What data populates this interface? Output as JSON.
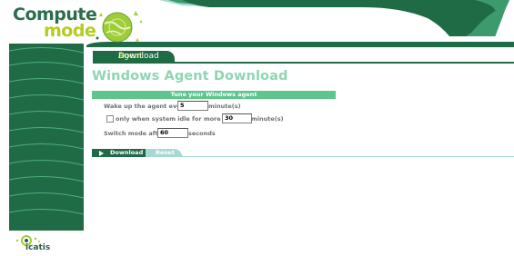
{
  "header": {
    "logo_line1": "Compute",
    "logo_line2": "mode",
    "logo_icon": "globe-icon"
  },
  "tab": {
    "label_part1": "Agent",
    "label_part2": " Download"
  },
  "page": {
    "title": "Windows Agent Download",
    "section_title": "Tune your Windows agent"
  },
  "form": {
    "wake_label": "Wake up the agent every",
    "wake_value": "5",
    "wake_unit": "minute(s)",
    "idle_label": "only when system idle for more than",
    "idle_checked": false,
    "idle_value": "30",
    "idle_unit": "minute(s)",
    "switch_label": "Switch mode after",
    "switch_value": "60",
    "switch_unit": "seconds"
  },
  "buttons": {
    "download_label": "Download",
    "reset_label": "Reset"
  },
  "footer": {
    "brand": "icatis",
    "brand_icon": "icatis-logo-icon"
  },
  "colors": {
    "dark_green": "#1f6b46",
    "light_green": "#5dc58d",
    "title_green": "#8fd6b2",
    "teal": "#a6d8d4",
    "lime": "#b4cc1e"
  }
}
